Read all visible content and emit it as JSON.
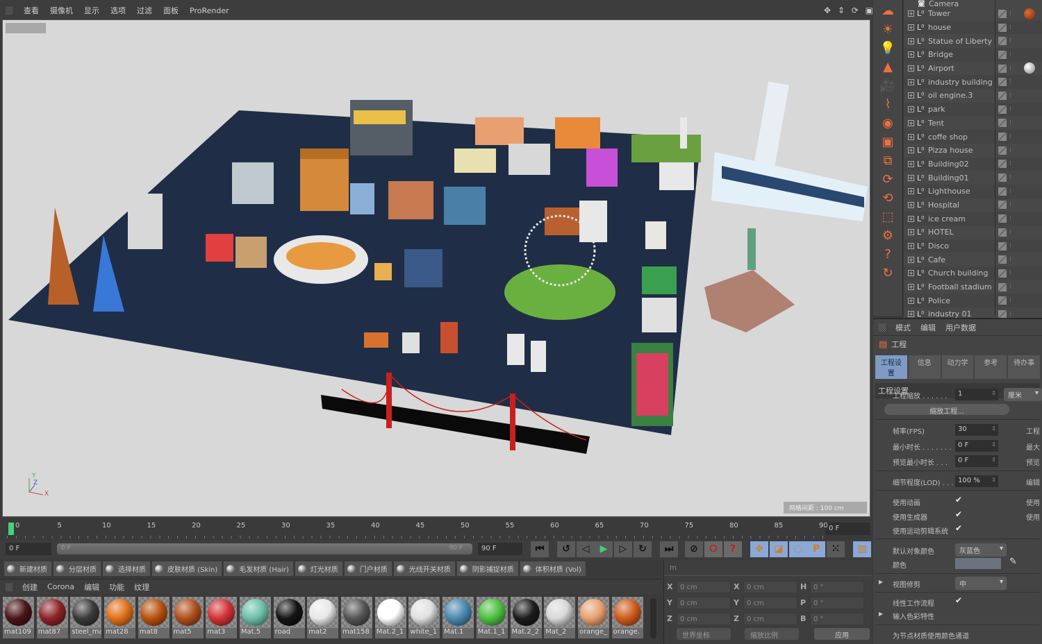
{
  "viewport_menu": [
    "查看",
    "摄像机",
    "显示",
    "选项",
    "过滤",
    "面板",
    "ProRender"
  ],
  "viewport": {
    "label": "",
    "grid_spacing": "网格间距 : 100 cm",
    "axis_labels": [
      "Y",
      "Z",
      "X"
    ]
  },
  "palette_icons": [
    "sky-icon",
    "sun-icon",
    "light-bulb-icon",
    "tree-icon",
    "camera-icon",
    "hair-icon",
    "material-icon",
    "render-view-icon",
    "nodes-icon",
    "refresh-icon",
    "interactive-render-icon",
    "region-render-icon",
    "settings-gear-icon",
    "help-icon",
    "reset-icon"
  ],
  "object_manager": {
    "top_item": "Camera",
    "items": [
      "Tower",
      "house",
      "Statue of Liberty",
      "Bridge",
      "Airport",
      "industry building",
      "oil engine.3",
      "park",
      "Tent",
      "coffe shop",
      "Pizza house",
      "Building02",
      "Building01",
      "Lighthouse",
      "Hospital",
      "ice cream",
      "HOTEL",
      "Disco",
      "Cafe",
      "Church building",
      "Football stadium",
      "Police",
      "industry 01"
    ]
  },
  "attributes": {
    "menu": [
      "模式",
      "编辑",
      "用户数据"
    ],
    "title": "工程",
    "tabs": [
      "工程设置",
      "信息",
      "动力学",
      "参考",
      "待办事"
    ],
    "section": "工程设置",
    "fields": {
      "scale_label": "工程缩放 . . . . . .",
      "scale_value": "1",
      "scale_unit": "厘米",
      "scale_button": "缩放工程...",
      "fps_label": "帧率(FPS)",
      "fps_value": "30",
      "min_time_label": "最小时长 . . . . . . .",
      "min_time_value": "0 F",
      "preview_min_label": "预览最小时长 . . .",
      "preview_min_value": "0 F",
      "lod_label": "细节程度(LOD) . . .",
      "lod_value": "100 %",
      "use_anim_label": "使用动画",
      "use_gen_label": "使用生成器",
      "use_motion_label": "使用运动剪辑系统",
      "default_color_label": "默认对象颜色",
      "default_color_value": "灰蓝色",
      "color_label": "颜色",
      "view_clip_label": "视图修剪",
      "view_clip_value": "中",
      "linear_label": "线性工作流程",
      "input_color_label": "输入色彩特性",
      "node_color_label": "为节点材质使用颜色通道"
    },
    "right_col": [
      "工程",
      "最大",
      "预览",
      "编辑",
      "使用",
      "使用"
    ],
    "color_swatch": "#6c7380"
  },
  "timeline": {
    "ticks": [
      "0",
      "5",
      "10",
      "15",
      "20",
      "25",
      "30",
      "35",
      "40",
      "45",
      "50",
      "55",
      "60",
      "65",
      "70",
      "75",
      "80",
      "85",
      "90"
    ],
    "current_frame": "0 F",
    "start_field": "0 F",
    "range_start": "0 F",
    "range_end": "90 F",
    "end_field": "90 F"
  },
  "transport_icons": [
    "go-to-start-icon",
    "previous-key-icon",
    "previous-frame-icon",
    "play-icon",
    "next-frame-icon",
    "next-key-icon",
    "go-to-end-icon",
    "record-off-icon",
    "autokey-icon",
    "keyframe-help-icon",
    "move-key-icon",
    "scale-key-icon",
    "rotate-key-icon",
    "param-key-icon",
    "pla-key-icon",
    "timeline-icon"
  ],
  "material_toolbar": [
    "新建材质",
    "分层材质",
    "选择材质",
    "皮肤材质 (Skin)",
    "毛发材质 (Hair)",
    "灯光材质",
    "门户材质",
    "光线开关材质",
    "阴影捕捉材质",
    "体积材质 (Vol)"
  ],
  "material_menu": [
    "创建",
    "Corona",
    "编辑",
    "功能",
    "纹理"
  ],
  "materials": [
    {
      "name": "mat109",
      "color": "#4a1518"
    },
    {
      "name": "mat87",
      "color": "#8e2228"
    },
    {
      "name": "steel_ma",
      "color": "#3a3a3a"
    },
    {
      "name": "mat28",
      "color": "#e0701a"
    },
    {
      "name": "mat8",
      "color": "#b8520f"
    },
    {
      "name": "mat5",
      "color": "#b04e1c"
    },
    {
      "name": "mat3",
      "color": "#d23236"
    },
    {
      "name": "Mat.5",
      "color": "#6cc0a8"
    },
    {
      "name": "road",
      "color": "#151515"
    },
    {
      "name": "mat2",
      "color": "#e8e8e8"
    },
    {
      "name": "mat158",
      "color": "#555555"
    },
    {
      "name": "Mat.2_1",
      "color": "#ffffff"
    },
    {
      "name": "white_1",
      "color": "#e0e0e0"
    },
    {
      "name": "Mat.1",
      "color": "#4a88b0"
    },
    {
      "name": "Mat.1_1",
      "color": "#4cc040"
    },
    {
      "name": "Mat.2_2",
      "color": "#1c1c1c"
    },
    {
      "name": "Mat_2",
      "color": "#d8d8d8"
    },
    {
      "name": "orange_",
      "color": "#e8a070"
    },
    {
      "name": "orange.",
      "color": "#d05a1c"
    }
  ],
  "coordinates": {
    "header": "m",
    "pos": [
      {
        "axis": "X",
        "value": "0 cm"
      },
      {
        "axis": "Y",
        "value": "0 cm"
      },
      {
        "axis": "Z",
        "value": "0 cm"
      }
    ],
    "size": [
      {
        "axis": "X",
        "value": "0 cm"
      },
      {
        "axis": "Y",
        "value": "0 cm"
      },
      {
        "axis": "Z",
        "value": "0 cm"
      }
    ],
    "rot": [
      {
        "axis": "H",
        "value": "0 °"
      },
      {
        "axis": "P",
        "value": "0 °"
      },
      {
        "axis": "B",
        "value": "0 °"
      }
    ],
    "coord_mode": "世界坐标",
    "scale_mode": "缩放比例",
    "apply": "应用"
  },
  "colors": {
    "accent_orange": "#f07040",
    "ground": "#1f2e46",
    "viewport_bg": "#d8d8d8",
    "play_green": "#3ed07a"
  }
}
